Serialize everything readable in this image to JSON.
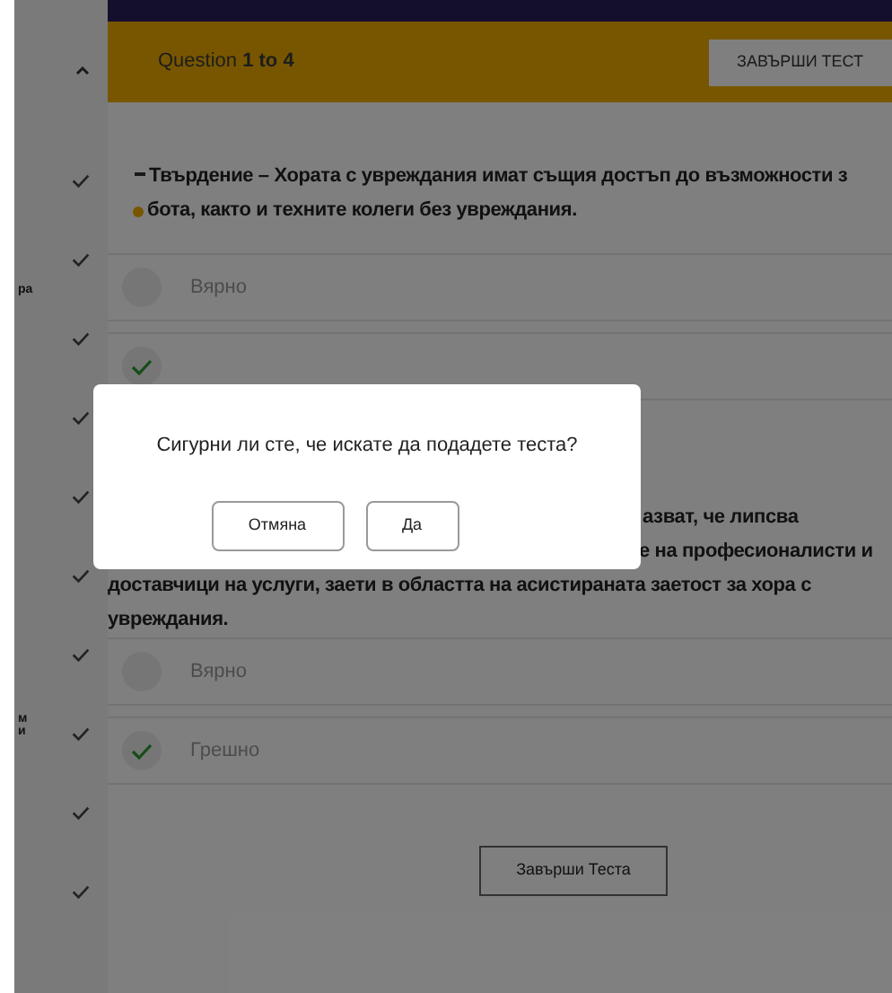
{
  "sidebar": {
    "items": [
      {
        "checked": true
      },
      {
        "checked": true,
        "label": "ра"
      },
      {
        "checked": true
      },
      {
        "checked": true
      },
      {
        "checked": true
      },
      {
        "checked": true
      },
      {
        "checked": true
      },
      {
        "checked": true,
        "label": "м\nи"
      },
      {
        "checked": true
      },
      {
        "checked": true
      }
    ]
  },
  "header": {
    "progress": "Question **1 to 4**",
    "finish_button": "ЗАВЪРШИ ТЕСТ"
  },
  "questions": [
    {
      "lines": [
        "Твърдение – Хората с увреждания имат същия достъп до възможности з",
        "бота, както и техните колеги без увреждания."
      ],
      "options": [
        {
          "label": "Вярно",
          "selected": false
        },
        {
          "selected": true
        }
      ]
    },
    {
      "lines": [
        "азват, че липсва",
        "е на професионалисти и",
        "доставчици на услуги, заети в областта на асистираната заетост за хора с",
        "увреждания."
      ],
      "options": [
        {
          "label": "Вярно",
          "selected": false
        },
        {
          "label": "Грешно",
          "selected": true
        }
      ]
    }
  ],
  "finish_button": "Завърши Теста",
  "dialog": {
    "message": "Сигурни ли сте, че искате да подадете теста?",
    "buttons": [
      "Отмяна",
      "Да"
    ]
  }
}
